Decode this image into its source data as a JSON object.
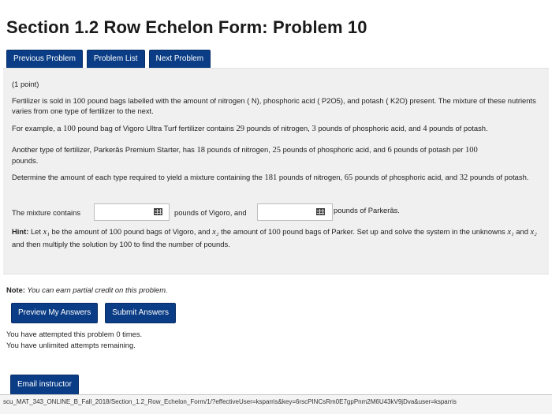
{
  "page": {
    "title": "Section 1.2 Row Echelon Form: Problem 10"
  },
  "nav": {
    "previous": "Previous Problem",
    "list": "Problem List",
    "next": "Next Problem"
  },
  "problem": {
    "points": "(1 point)",
    "para1": "Fertilizer is sold in 100 pound bags labelled with the amount of nitrogen ( N), phosphoric acid ( P2O5), and potash ( K2O) present. The mixture of these nutrients varies from one type of fertilizer to the next.",
    "para2_a": "For example, a ",
    "para2_n1": "100",
    "para2_b": " pound bag of Vigoro Ultra Turf fertilizer contains ",
    "para2_n2": "29",
    "para2_c": " pounds of nitrogen, ",
    "para2_n3": "3",
    "para2_d": " pounds of phosphoric acid, and ",
    "para2_n4": "4",
    "para2_e": " pounds of potash.",
    "para3_a": "Another type of fertilizer, Parkerâs Premium Starter, has ",
    "para3_n1": "18",
    "para3_b": " pounds of nitrogen, ",
    "para3_n2": "25",
    "para3_c": " pounds of phosphoric acid, and ",
    "para3_n3": "6",
    "para3_d": " pounds of potash per ",
    "para3_n4": "100",
    "para3_e": "pounds.",
    "para4_a": "Determine the amount of each type required to yield a mixture containing the ",
    "para4_n1": "181",
    "para4_b": " pounds of nitrogen, ",
    "para4_n2": "65",
    "para4_c": " pounds of phosphoric acid, and ",
    "para4_n3": "32",
    "para4_d": " pounds of potash.",
    "mixture_label": "The mixture contains",
    "vigoro_label": "pounds of Vigoro, and",
    "parker_label": "pounds of Parkerâs.",
    "answer1_value": "",
    "answer2_value": "",
    "hint_label": "Hint:",
    "hint_a": " Let ",
    "hint_x1": "x₁",
    "hint_b": " be the amount of 100 pound bags of Vigoro, and ",
    "hint_x2": "x₂",
    "hint_c": " the amount of 100 pound bags of Parker. Set up and solve the system in the unknowns ",
    "hint_x1b": "x₁",
    "hint_d": " and ",
    "hint_x2b": "x₂",
    "hint_e": " and then multiply the solution by 100 to find the number of pounds."
  },
  "note": {
    "label": "Note:",
    "text": " You can earn partial credit on this problem."
  },
  "actions": {
    "preview": "Preview My Answers",
    "submit": "Submit Answers"
  },
  "attempts": {
    "line1": "You have attempted this problem 0 times.",
    "line2": "You have unlimited attempts remaining."
  },
  "email": {
    "label": "Email instructor"
  },
  "status": {
    "url": "scu_MAT_343_ONLINE_B_Fall_2018/Section_1.2_Row_Echelon_Form/1/?effectiveUser=ksparris&key=6rscPINCsRm0E7gpPnm2M6U43kV9jDva&user=ksparris"
  },
  "colors": {
    "button_bg": "#0a3d86",
    "panel_bg": "#f0f0f0"
  }
}
